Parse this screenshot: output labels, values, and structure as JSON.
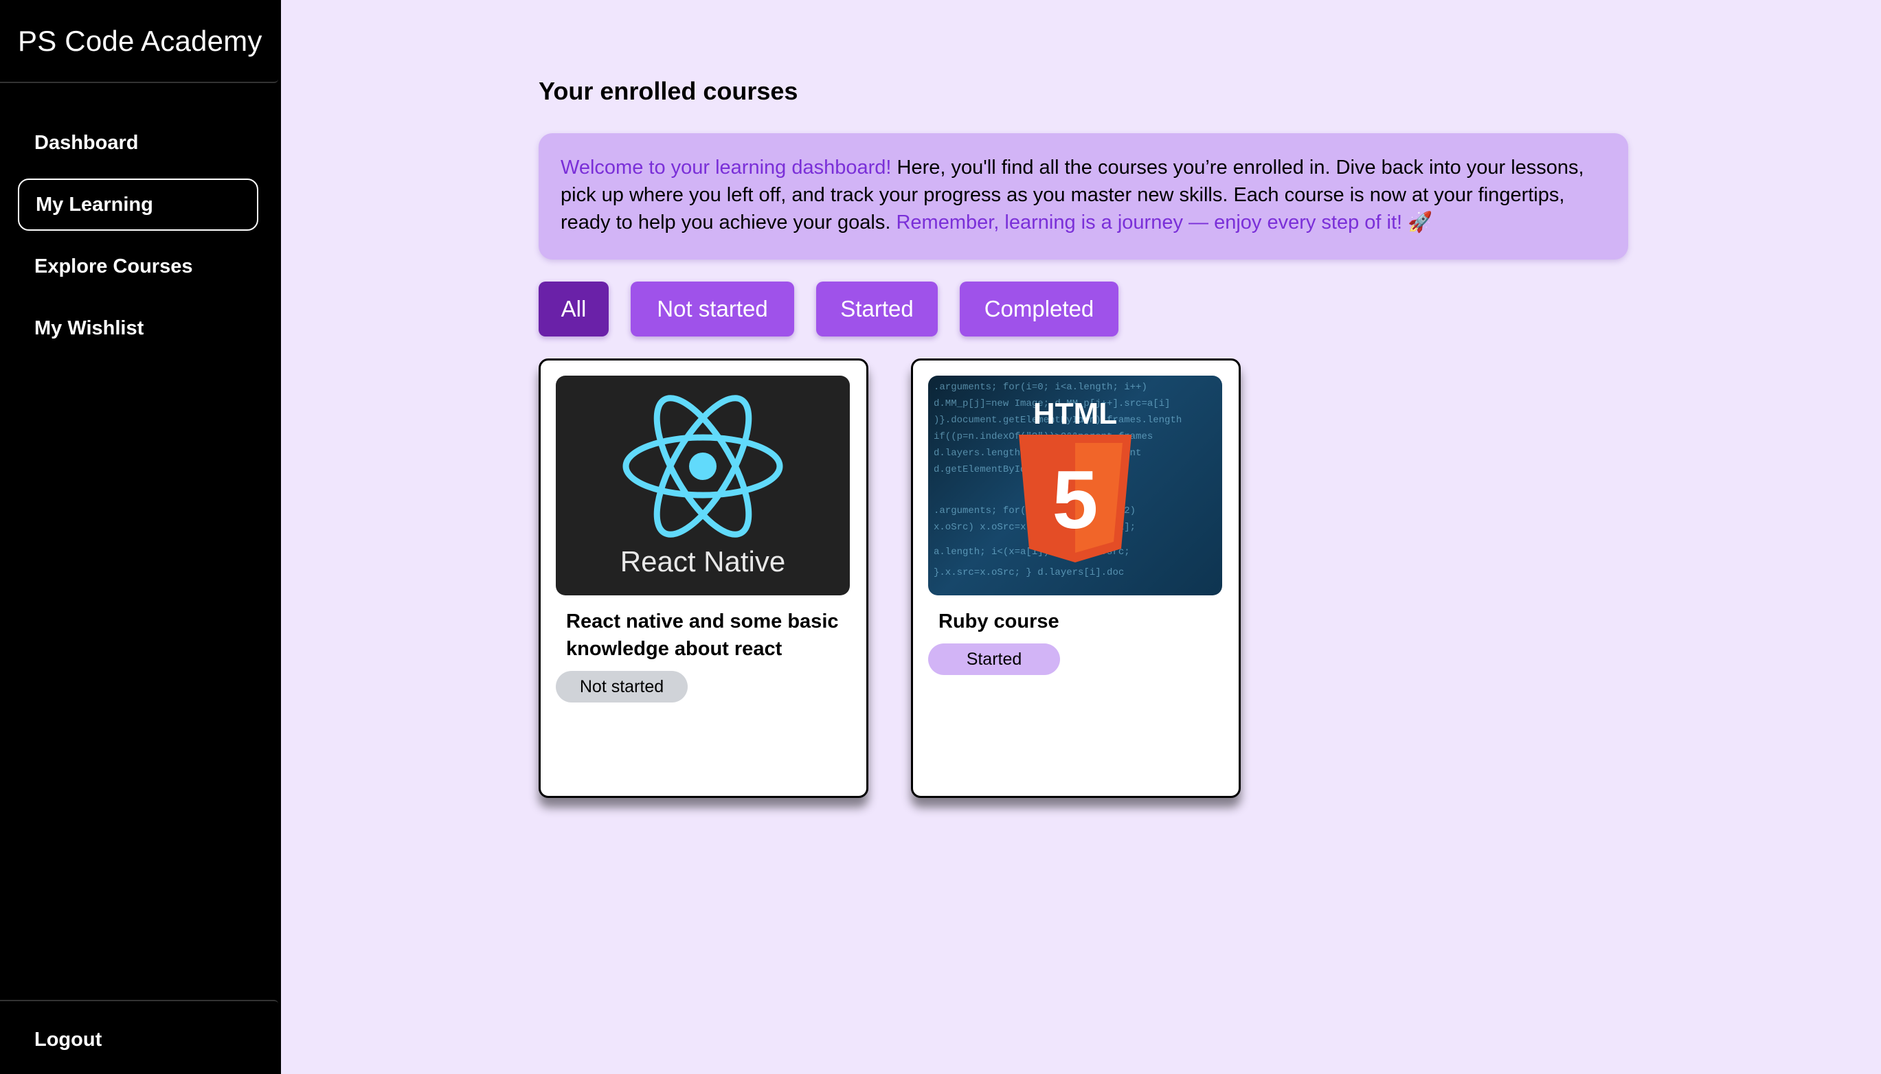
{
  "sidebar": {
    "brand": "PS Code Academy",
    "items": [
      {
        "label": "Dashboard",
        "active": false
      },
      {
        "label": "My Learning",
        "active": true
      },
      {
        "label": "Explore Courses",
        "active": false
      },
      {
        "label": "My Wishlist",
        "active": false
      }
    ],
    "logout": "Logout"
  },
  "main": {
    "title": "Your enrolled courses",
    "welcome": {
      "lead": "Welcome to your learning dashboard!",
      "body": " Here, you'll find all the courses you’re enrolled in. Dive back into your lessons, pick up where you left off, and track your progress as you master new skills. Each course is now at your fingertips, ready to help you achieve your goals. ",
      "closing": "Remember, learning is a journey — enjoy every step of it!",
      "emoji": "🚀"
    },
    "filters": [
      {
        "label": "All",
        "active": true
      },
      {
        "label": "Not started",
        "active": false
      },
      {
        "label": "Started",
        "active": false
      },
      {
        "label": "Completed",
        "active": false
      }
    ],
    "courses": [
      {
        "image_icon": "react-native-logo",
        "image_text": "React Native",
        "title": "React native and some basic knowledge about react",
        "status": "Not started",
        "status_color": "#d0d3d8"
      },
      {
        "image_icon": "html5-logo",
        "image_text": "HTML",
        "image_number": "5",
        "title": "Ruby course",
        "status": "Started",
        "status_color": "#d2b4f6"
      }
    ]
  },
  "colors": {
    "page_bg": "#f0e6fd",
    "sidebar_bg": "#000000",
    "accent": "#9f52ea",
    "accent_active": "#6a21a8",
    "highlight_text": "#7a2fd8",
    "banner_bg": "#d2b4f6"
  }
}
